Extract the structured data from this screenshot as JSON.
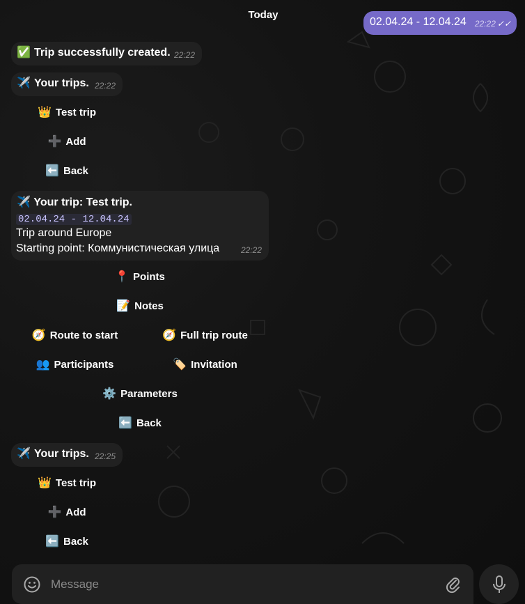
{
  "date_label": "Today",
  "outgoing": {
    "text": "02.04.24 - 12.04.24",
    "time": "22:22",
    "status": "read-double-check"
  },
  "msg_created": {
    "emoji": "✅",
    "text": "Trip successfully created.",
    "time": "22:22"
  },
  "msg_trips_1": {
    "emoji": "✈️",
    "text": "Your trips.",
    "time": "22:22"
  },
  "kb_trips_1": [
    {
      "icon": "👑",
      "label": "Test trip"
    },
    {
      "icon": "➕",
      "label": "Add"
    },
    {
      "icon": "⬅️",
      "label": "Back"
    }
  ],
  "msg_trip": {
    "emoji": "✈️",
    "title": "Your trip: Test trip.",
    "dates": "02.04.24 - 12.04.24",
    "description": "Trip around Europe",
    "start": "Starting point: Коммунистическая улица",
    "time": "22:22"
  },
  "kb_trip": {
    "points": {
      "icon": "📍",
      "label": "Points"
    },
    "notes": {
      "icon": "📝",
      "label": "Notes"
    },
    "route_start": {
      "icon": "🧭",
      "label": "Route to start"
    },
    "full_route": {
      "icon": "🧭",
      "label": "Full trip route"
    },
    "participants": {
      "icon": "👥",
      "label": "Participants"
    },
    "invitation": {
      "icon": "🏷️",
      "label": "Invitation"
    },
    "parameters": {
      "icon": "⚙️",
      "label": "Parameters"
    },
    "back": {
      "icon": "⬅️",
      "label": "Back"
    }
  },
  "msg_trips_2": {
    "emoji": "✈️",
    "text": "Your trips.",
    "time": "22:25"
  },
  "kb_trips_2": [
    {
      "icon": "👑",
      "label": "Test trip"
    },
    {
      "icon": "➕",
      "label": "Add"
    },
    {
      "icon": "⬅️",
      "label": "Back"
    }
  ],
  "composer": {
    "placeholder": "Message",
    "emoji_icon": "smile-icon",
    "attach_icon": "paperclip-icon",
    "mic_icon": "microphone-icon"
  },
  "colors": {
    "background": "#0f0f0f",
    "bubble_in": "#212121",
    "bubble_out": "#766ac8",
    "accent": "#c9c4ff"
  }
}
